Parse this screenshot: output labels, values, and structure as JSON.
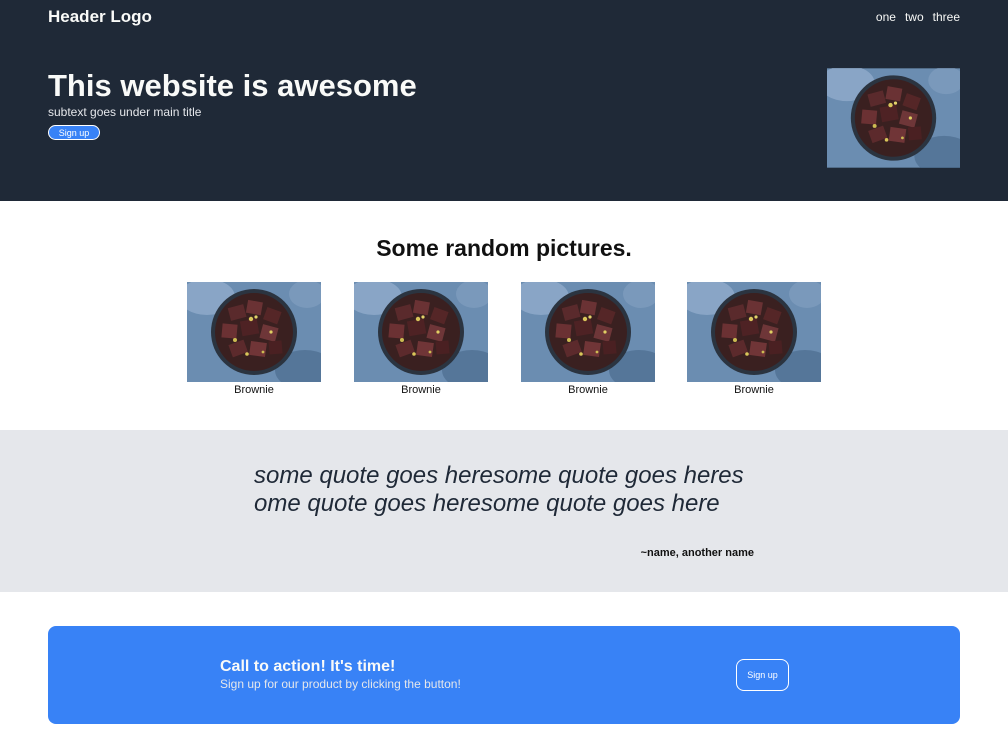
{
  "header": {
    "logo": "Header Logo",
    "nav": [
      "one",
      "two",
      "three"
    ],
    "hero_title": "This website is awesome",
    "hero_subtitle": "subtext goes under main title",
    "signup_label": "Sign up",
    "hero_image_icon": "brownie-photo"
  },
  "info": {
    "title": "Some random pictures.",
    "cards": [
      {
        "label": "Brownie",
        "image_icon": "brownie-photo"
      },
      {
        "label": "Brownie",
        "image_icon": "brownie-photo"
      },
      {
        "label": "Brownie",
        "image_icon": "brownie-photo"
      },
      {
        "label": "Brownie",
        "image_icon": "brownie-photo"
      }
    ]
  },
  "quote": {
    "text": "some quote goes heresome quote goes heresome quote goes heresome quote goes here",
    "author": "~name, another name"
  },
  "cta": {
    "title": "Call to action! It's time!",
    "subtitle": "Sign up for our product by clicking the button!",
    "button_label": "Sign up"
  },
  "colors": {
    "header_bg": "#1f2937",
    "accent": "#3882f6",
    "quote_bg": "#e5e7eb",
    "light_text": "#f9faf8"
  }
}
